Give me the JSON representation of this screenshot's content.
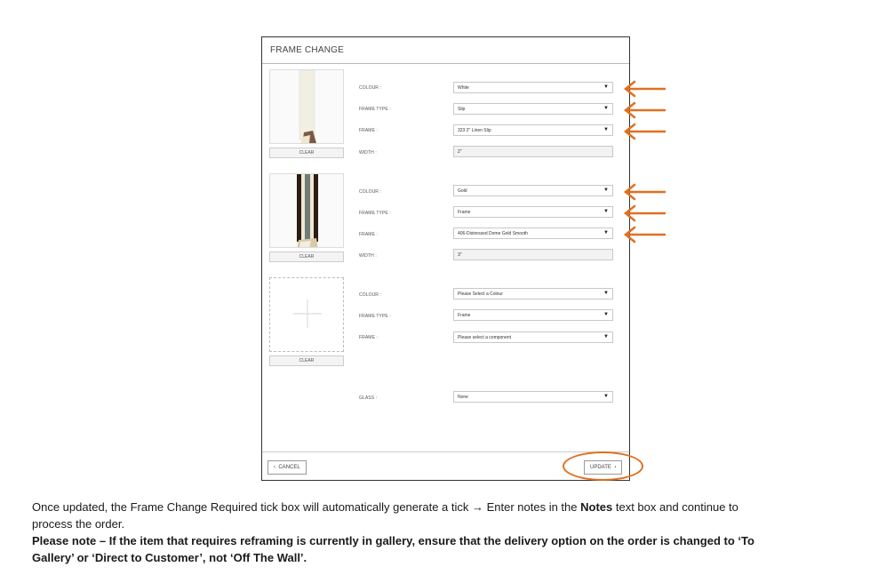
{
  "dialog": {
    "title": "FRAME CHANGE",
    "sections": [
      {
        "clear_label": "CLEAR",
        "rows": [
          {
            "label": "COLOUR :",
            "value": "White",
            "type": "select"
          },
          {
            "label": "FRAME TYPE :",
            "value": "Slip",
            "type": "select"
          },
          {
            "label": "FRAME :",
            "value": "323 2\" Linen Slip",
            "type": "select"
          },
          {
            "label": "WIDTH :",
            "value": "2\"",
            "type": "text"
          }
        ]
      },
      {
        "clear_label": "CLEAR",
        "rows": [
          {
            "label": "COLOUR :",
            "value": "Gold",
            "type": "select"
          },
          {
            "label": "FRAME TYPE :",
            "value": "Frame",
            "type": "select"
          },
          {
            "label": "FRAME :",
            "value": "406-Distressed Dome Gold Smooth",
            "type": "select"
          },
          {
            "label": "WIDTH :",
            "value": "3\"",
            "type": "text"
          }
        ]
      },
      {
        "clear_label": "CLEAR",
        "rows": [
          {
            "label": "COLOUR :",
            "value": "Please Select a Colour",
            "type": "select"
          },
          {
            "label": "FRAME TYPE :",
            "value": "Frame",
            "type": "select"
          },
          {
            "label": "FRAME :",
            "value": "Please select a component",
            "type": "select"
          }
        ]
      }
    ],
    "glass": {
      "label": "GLASS :",
      "value": "None"
    },
    "cancel_label": "CANCEL",
    "update_label": "UPDATE"
  },
  "annotation_color": "#e07020",
  "icons": [
    "chevron-left-icon",
    "chevron-right-icon",
    "plus-icon",
    "dropdown-caret-icon",
    "arrow-left-icon"
  ],
  "instructions": {
    "line1_a": "Once updated, the Frame Change Required tick box will automatically generate a tick ",
    "line1_arrow": "→",
    "line1_b": " Enter notes in the ",
    "line1_bold": "Notes",
    "line1_c": " text box and continue to",
    "line2": "process the order.",
    "note": "Please note – If the item that requires reframing is currently in gallery, ensure that the delivery option on the order is changed to ‘To",
    "note2": "Gallery’ or ‘Direct to Customer’, not ‘Off The Wall’."
  }
}
